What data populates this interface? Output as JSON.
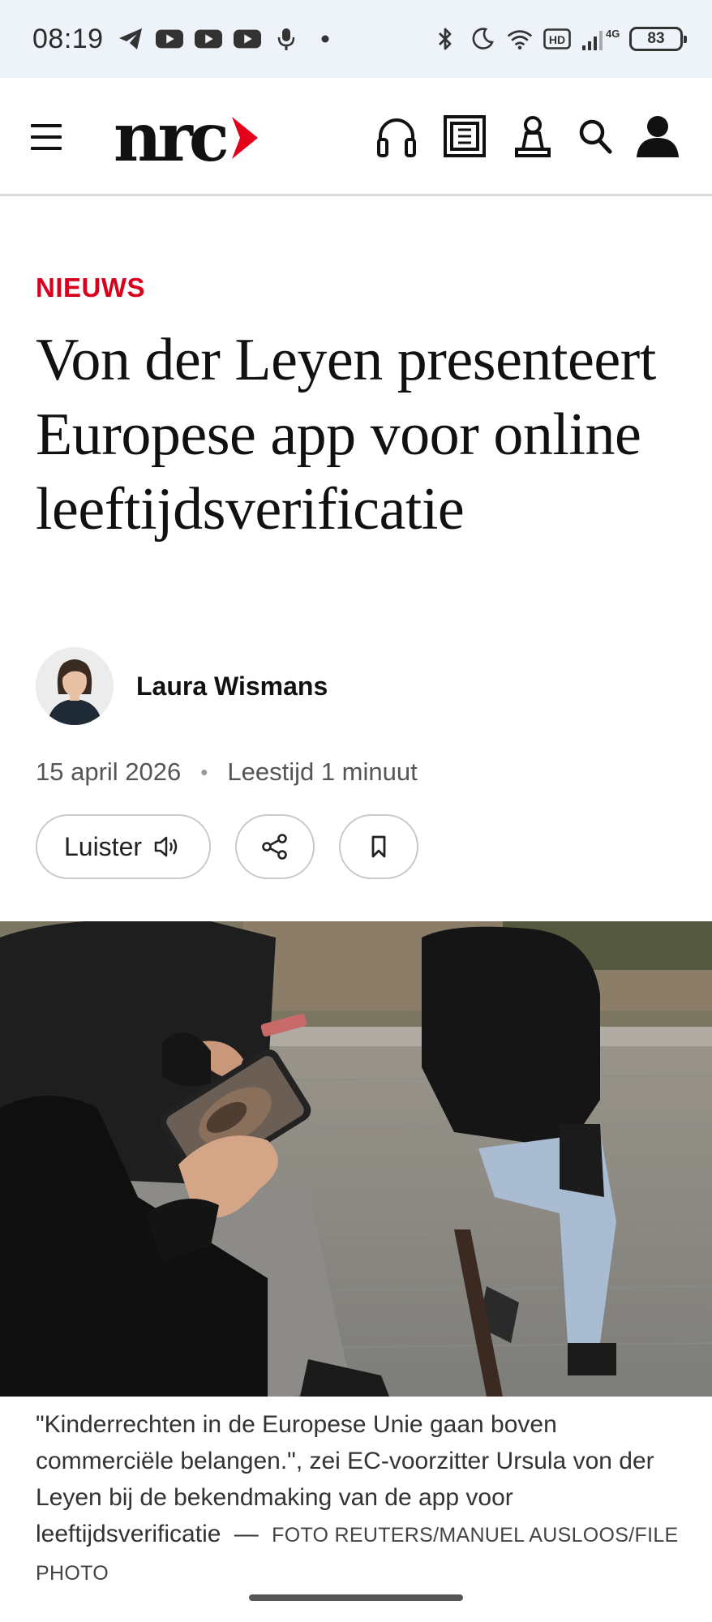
{
  "status_bar": {
    "time": "08:19",
    "left_icons": [
      "telegram-icon",
      "youtube-icon",
      "youtube-icon",
      "youtube-icon",
      "microphone-icon",
      "dot-icon"
    ],
    "right_icons": [
      "bluetooth-icon",
      "moon-icon",
      "wifi-icon",
      "hd-icon",
      "signal-icon"
    ],
    "network": "4G",
    "battery": "83"
  },
  "header": {
    "logo_text": "nrc",
    "brand_color": "#e3001b",
    "icons": [
      "headphones-icon",
      "newspaper-icon",
      "chess-pawn-icon",
      "search-icon",
      "account-icon"
    ]
  },
  "article": {
    "category": "NIEUWS",
    "title": "Von der Leyen presenteert Europese app voor online leeftijdsverificatie",
    "author": "Laura Wismans",
    "date": "15 april 2026",
    "meta_separator": "•",
    "reading_time": "Leestijd 1 minuut",
    "listen_label": "Luister",
    "caption_text": "\"Kinderrechten in de Europese Unie gaan boven commerciële belangen.\", zei EC-voorzitter Ursula von der Leyen bij de bekendmaking van de app voor leeftijdsverificatie",
    "caption_dash": "—",
    "photo_credit": "FOTO REUTERS/MANUEL AUSLOOS/FILE PHOTO"
  }
}
